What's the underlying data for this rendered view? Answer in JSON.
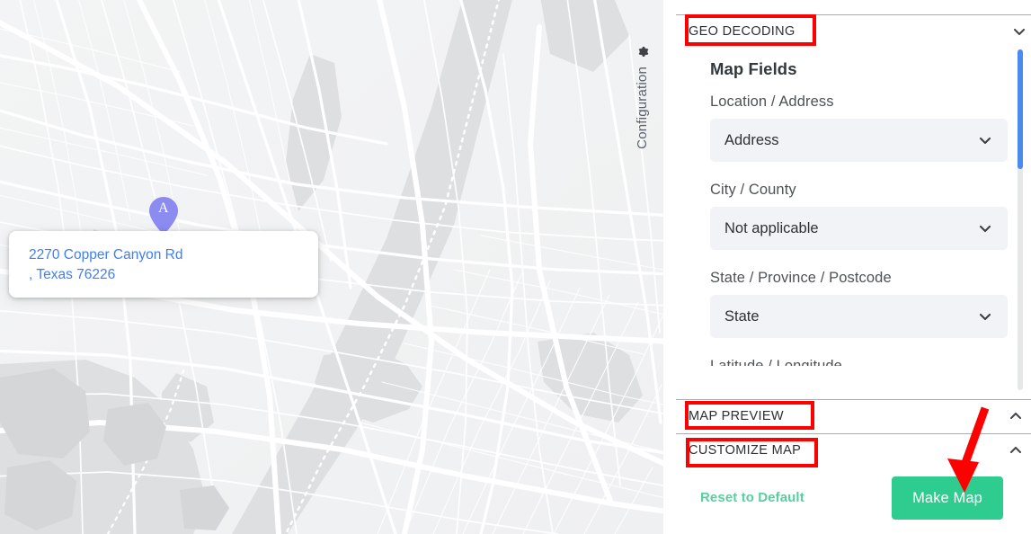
{
  "map": {
    "name": "map-canvas",
    "marker": {
      "letter": "A",
      "color": "#8c8cf0"
    },
    "popup": {
      "line1": "2270 Copper Canyon Rd",
      "line2": ", Texas 76226",
      "text_color": "#3f7ff5"
    }
  },
  "config_tab": {
    "icon": "gear-icon",
    "glyph": "✿",
    "label": "Configuration"
  },
  "panel": {
    "sections": [
      {
        "id": "geo",
        "title": "GEO DECODING",
        "chevron": "chevron-down-icon",
        "expanded": true
      },
      {
        "id": "preview",
        "title": "MAP PREVIEW",
        "chevron": "chevron-up-icon",
        "expanded": false
      },
      {
        "id": "customize",
        "title": "CUSTOMIZE MAP",
        "chevron": "chevron-up-icon",
        "expanded": false
      }
    ],
    "geo": {
      "heading": "Map Fields",
      "fields": [
        {
          "label": "Location / Address",
          "value": "Address",
          "chevron": "chevron-down-icon"
        },
        {
          "label": "City / County",
          "value": "Not applicable",
          "chevron": "chevron-down-icon"
        },
        {
          "label": "State / Province / Postcode",
          "value": "State",
          "chevron": "chevron-down-icon"
        }
      ],
      "clipped_field_label": "Latitude / Longitude"
    },
    "footer": {
      "reset_label": "Reset to Default",
      "reset_color": "#58cfa0",
      "make_map_label": "Make Map",
      "make_map_color": "#2ecc8f"
    },
    "scrollbar": {
      "thumb_color": "#4b8bee",
      "track_color": "#e6e7e9"
    }
  },
  "annotations": {
    "highlight_color": "#fe0000",
    "boxes": [
      "GEO DECODING",
      "MAP PREVIEW",
      "CUSTOMIZE MAP"
    ],
    "arrow_target": "Make Map"
  }
}
